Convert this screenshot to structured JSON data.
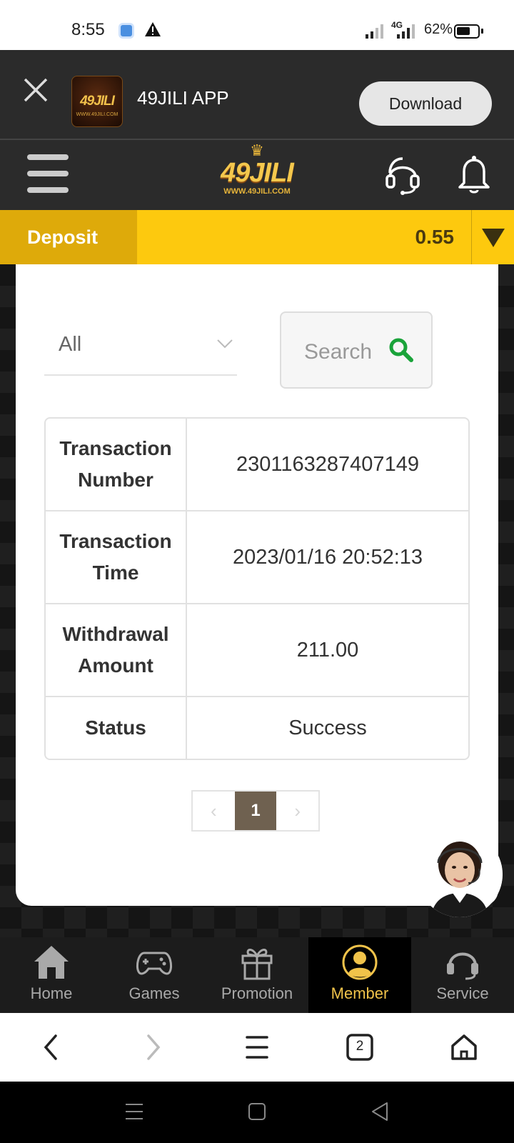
{
  "status_bar": {
    "time": "8:55",
    "network": "4G",
    "battery": "62%",
    "icons": [
      "app-notification-icon",
      "warning-icon",
      "signal-icon",
      "signal-4g-icon",
      "battery-icon"
    ]
  },
  "app_banner": {
    "app_name": "49JILI APP",
    "logo_text": "49JILI",
    "logo_url": "WWW.49JILI.COM",
    "download_label": "Download"
  },
  "header": {
    "logo_text": "49JILI",
    "logo_url": "WWW.49JILI.COM"
  },
  "deposit_bar": {
    "deposit_label": "Deposit",
    "balance": "0.55"
  },
  "filter": {
    "selected": "All",
    "search_label": "Search"
  },
  "transaction": {
    "rows": [
      {
        "label": "Transaction Number",
        "value": "2301163287407149"
      },
      {
        "label": "Transaction Time",
        "value": "2023/01/16 20:52:13"
      },
      {
        "label": "Withdrawal Amount",
        "value": "211.00"
      },
      {
        "label": "Status",
        "value": "Success"
      }
    ]
  },
  "pagination": {
    "prev": "‹",
    "current": "1",
    "next": "›"
  },
  "bottom_nav": {
    "items": [
      {
        "label": "Home",
        "icon": "home-icon"
      },
      {
        "label": "Games",
        "icon": "gamepad-icon"
      },
      {
        "label": "Promotion",
        "icon": "gift-icon"
      },
      {
        "label": "Member",
        "icon": "member-icon",
        "active": true
      },
      {
        "label": "Service",
        "icon": "headset-icon"
      }
    ]
  },
  "browser_bar": {
    "tab_count": "2"
  },
  "colors": {
    "accent_yellow": "#fdc90e",
    "deposit_dark": "#deaa0a",
    "active_gold": "#f1c34a",
    "search_green": "#1aa33a",
    "page_active": "#6f6150"
  }
}
